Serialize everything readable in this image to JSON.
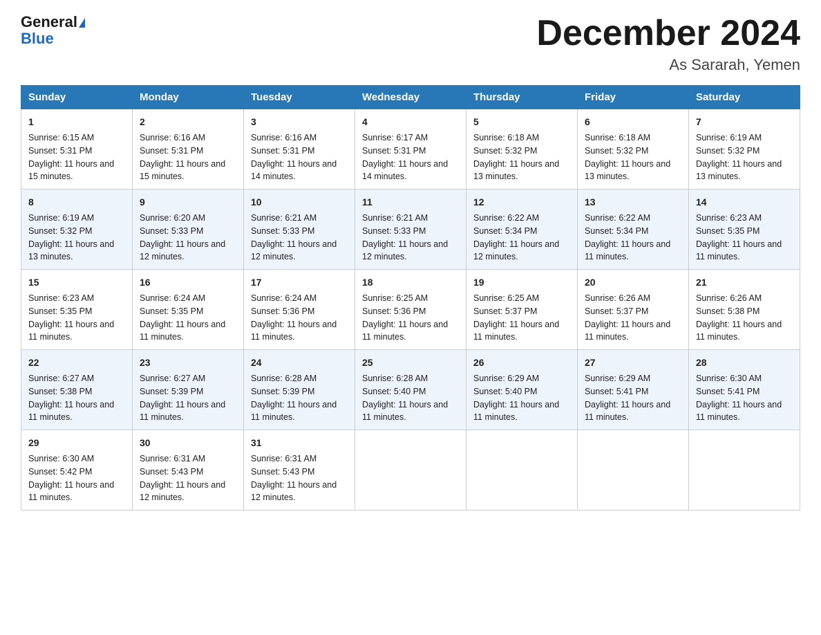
{
  "logo": {
    "general": "General",
    "blue": "Blue"
  },
  "title": "December 2024",
  "subtitle": "As Sararah, Yemen",
  "days_of_week": [
    "Sunday",
    "Monday",
    "Tuesday",
    "Wednesday",
    "Thursday",
    "Friday",
    "Saturday"
  ],
  "weeks": [
    [
      {
        "day": "1",
        "sunrise": "6:15 AM",
        "sunset": "5:31 PM",
        "daylight": "11 hours and 15 minutes."
      },
      {
        "day": "2",
        "sunrise": "6:16 AM",
        "sunset": "5:31 PM",
        "daylight": "11 hours and 15 minutes."
      },
      {
        "day": "3",
        "sunrise": "6:16 AM",
        "sunset": "5:31 PM",
        "daylight": "11 hours and 14 minutes."
      },
      {
        "day": "4",
        "sunrise": "6:17 AM",
        "sunset": "5:31 PM",
        "daylight": "11 hours and 14 minutes."
      },
      {
        "day": "5",
        "sunrise": "6:18 AM",
        "sunset": "5:32 PM",
        "daylight": "11 hours and 13 minutes."
      },
      {
        "day": "6",
        "sunrise": "6:18 AM",
        "sunset": "5:32 PM",
        "daylight": "11 hours and 13 minutes."
      },
      {
        "day": "7",
        "sunrise": "6:19 AM",
        "sunset": "5:32 PM",
        "daylight": "11 hours and 13 minutes."
      }
    ],
    [
      {
        "day": "8",
        "sunrise": "6:19 AM",
        "sunset": "5:32 PM",
        "daylight": "11 hours and 13 minutes."
      },
      {
        "day": "9",
        "sunrise": "6:20 AM",
        "sunset": "5:33 PM",
        "daylight": "11 hours and 12 minutes."
      },
      {
        "day": "10",
        "sunrise": "6:21 AM",
        "sunset": "5:33 PM",
        "daylight": "11 hours and 12 minutes."
      },
      {
        "day": "11",
        "sunrise": "6:21 AM",
        "sunset": "5:33 PM",
        "daylight": "11 hours and 12 minutes."
      },
      {
        "day": "12",
        "sunrise": "6:22 AM",
        "sunset": "5:34 PM",
        "daylight": "11 hours and 12 minutes."
      },
      {
        "day": "13",
        "sunrise": "6:22 AM",
        "sunset": "5:34 PM",
        "daylight": "11 hours and 11 minutes."
      },
      {
        "day": "14",
        "sunrise": "6:23 AM",
        "sunset": "5:35 PM",
        "daylight": "11 hours and 11 minutes."
      }
    ],
    [
      {
        "day": "15",
        "sunrise": "6:23 AM",
        "sunset": "5:35 PM",
        "daylight": "11 hours and 11 minutes."
      },
      {
        "day": "16",
        "sunrise": "6:24 AM",
        "sunset": "5:35 PM",
        "daylight": "11 hours and 11 minutes."
      },
      {
        "day": "17",
        "sunrise": "6:24 AM",
        "sunset": "5:36 PM",
        "daylight": "11 hours and 11 minutes."
      },
      {
        "day": "18",
        "sunrise": "6:25 AM",
        "sunset": "5:36 PM",
        "daylight": "11 hours and 11 minutes."
      },
      {
        "day": "19",
        "sunrise": "6:25 AM",
        "sunset": "5:37 PM",
        "daylight": "11 hours and 11 minutes."
      },
      {
        "day": "20",
        "sunrise": "6:26 AM",
        "sunset": "5:37 PM",
        "daylight": "11 hours and 11 minutes."
      },
      {
        "day": "21",
        "sunrise": "6:26 AM",
        "sunset": "5:38 PM",
        "daylight": "11 hours and 11 minutes."
      }
    ],
    [
      {
        "day": "22",
        "sunrise": "6:27 AM",
        "sunset": "5:38 PM",
        "daylight": "11 hours and 11 minutes."
      },
      {
        "day": "23",
        "sunrise": "6:27 AM",
        "sunset": "5:39 PM",
        "daylight": "11 hours and 11 minutes."
      },
      {
        "day": "24",
        "sunrise": "6:28 AM",
        "sunset": "5:39 PM",
        "daylight": "11 hours and 11 minutes."
      },
      {
        "day": "25",
        "sunrise": "6:28 AM",
        "sunset": "5:40 PM",
        "daylight": "11 hours and 11 minutes."
      },
      {
        "day": "26",
        "sunrise": "6:29 AM",
        "sunset": "5:40 PM",
        "daylight": "11 hours and 11 minutes."
      },
      {
        "day": "27",
        "sunrise": "6:29 AM",
        "sunset": "5:41 PM",
        "daylight": "11 hours and 11 minutes."
      },
      {
        "day": "28",
        "sunrise": "6:30 AM",
        "sunset": "5:41 PM",
        "daylight": "11 hours and 11 minutes."
      }
    ],
    [
      {
        "day": "29",
        "sunrise": "6:30 AM",
        "sunset": "5:42 PM",
        "daylight": "11 hours and 11 minutes."
      },
      {
        "day": "30",
        "sunrise": "6:31 AM",
        "sunset": "5:43 PM",
        "daylight": "11 hours and 12 minutes."
      },
      {
        "day": "31",
        "sunrise": "6:31 AM",
        "sunset": "5:43 PM",
        "daylight": "11 hours and 12 minutes."
      },
      null,
      null,
      null,
      null
    ]
  ]
}
